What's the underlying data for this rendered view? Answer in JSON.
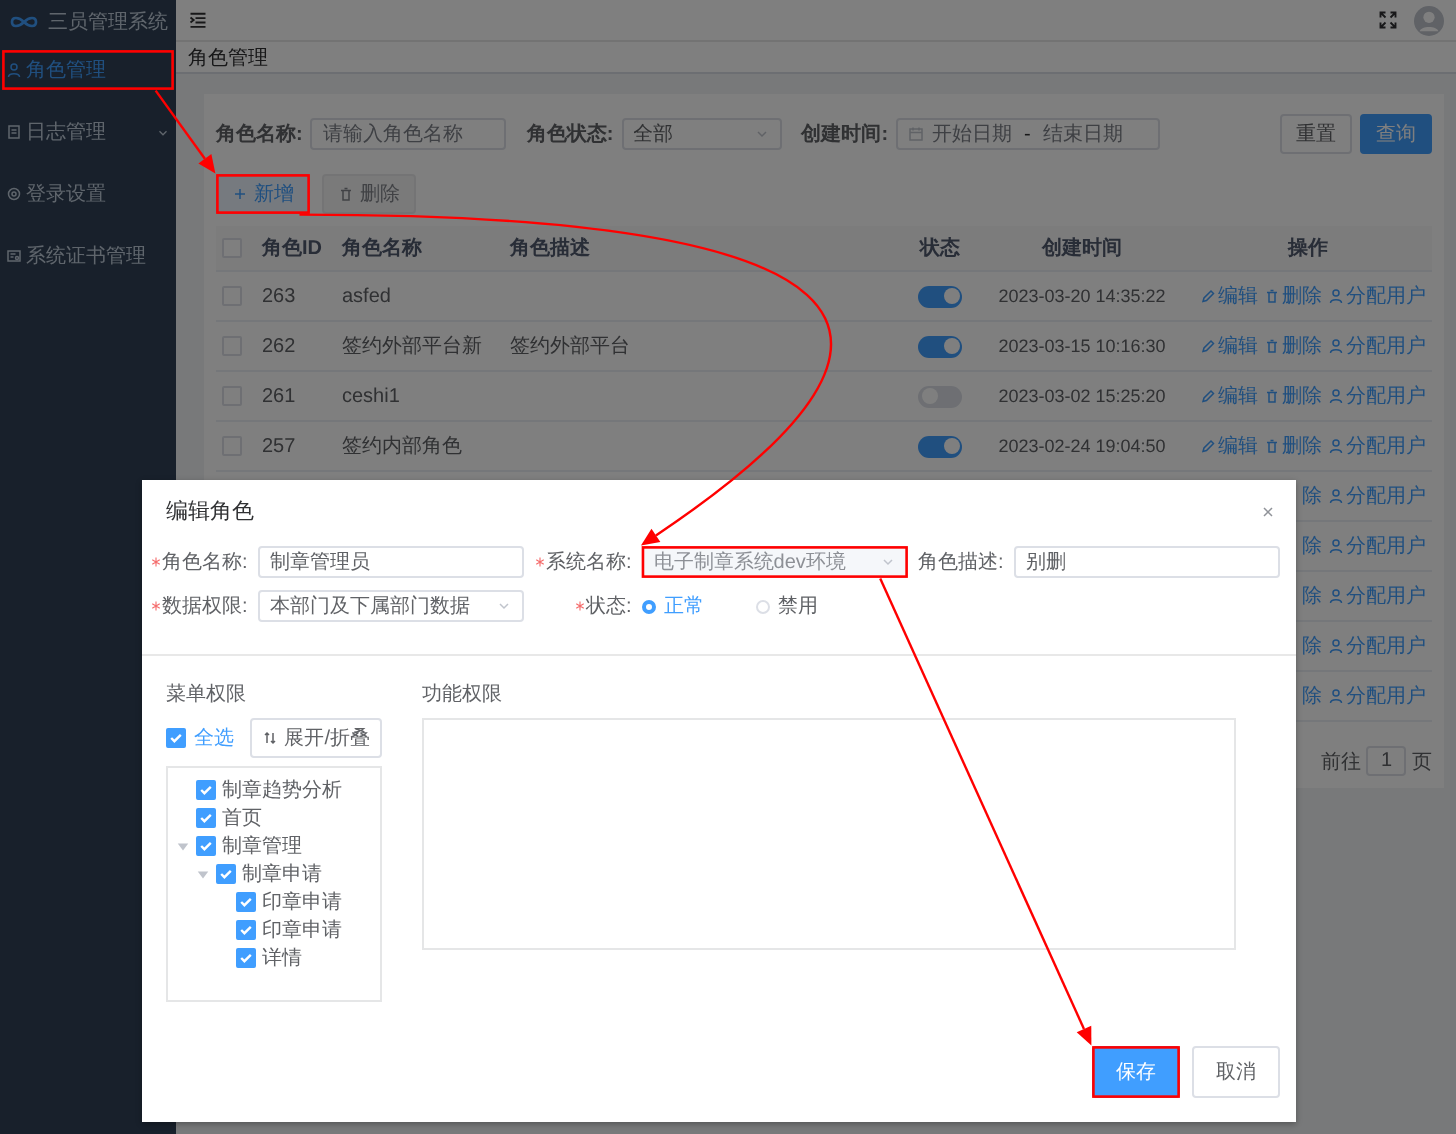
{
  "app": {
    "title": "三员管理系统"
  },
  "sidebar": {
    "items": [
      {
        "label": "角色管理",
        "selected": true,
        "submenu": false,
        "highlighted": true
      },
      {
        "label": "日志管理",
        "selected": false,
        "submenu": true,
        "highlighted": false
      },
      {
        "label": "登录设置",
        "selected": false,
        "submenu": false,
        "highlighted": false
      },
      {
        "label": "系统证书管理",
        "selected": false,
        "submenu": false,
        "highlighted": false
      }
    ]
  },
  "page_title": "角色管理",
  "filters": [
    {
      "kind": "input",
      "label": "角色名称:",
      "placeholder": "请输入角色名称"
    },
    {
      "kind": "select",
      "label": "角色状态:",
      "value": "全部"
    },
    {
      "kind": "daterange",
      "label": "创建时间:",
      "start_placeholder": "开始日期",
      "separator": "-",
      "end_placeholder": "结束日期"
    }
  ],
  "filter_buttons": [
    {
      "label": "重置",
      "primary": false
    },
    {
      "label": "查询",
      "primary": true
    }
  ],
  "toolbar": [
    {
      "kind": "add",
      "label": "新增",
      "disabled": false,
      "highlighted": true
    },
    {
      "kind": "delete",
      "label": "删除",
      "disabled": true,
      "highlighted": false
    }
  ],
  "table": {
    "select_all_checked": false,
    "columns": [
      "角色ID",
      "角色名称",
      "角色描述",
      "状态",
      "创建时间",
      "操作"
    ],
    "rows": [
      {
        "id": "263",
        "name": "asfed",
        "checked": false,
        "on": true,
        "created": "2023-03-20 14:35:22",
        "actions": [
          {
            "kind": "edit",
            "label": "编辑"
          },
          {
            "kind": "delete",
            "label": "删除"
          },
          {
            "kind": "assign",
            "label": "分配用户"
          }
        ]
      },
      {
        "id": "262",
        "name": "签约外部平台新",
        "description": "签约外部平台",
        "checked": false,
        "on": true,
        "created": "2023-03-15 10:16:30",
        "actions": [
          {
            "kind": "edit",
            "label": "编辑"
          },
          {
            "kind": "delete",
            "label": "删除"
          },
          {
            "kind": "assign",
            "label": "分配用户"
          }
        ]
      },
      {
        "id": "261",
        "name": "ceshi1",
        "checked": false,
        "on": false,
        "created": "2023-03-02 15:25:20",
        "actions": [
          {
            "kind": "edit",
            "label": "编辑"
          },
          {
            "kind": "delete",
            "label": "删除"
          },
          {
            "kind": "assign",
            "label": "分配用户"
          }
        ]
      },
      {
        "id": "257",
        "name": "签约内部角色",
        "checked": false,
        "on": true,
        "created": "2023-02-24 19:04:50",
        "actions": [
          {
            "kind": "edit",
            "label": "编辑"
          },
          {
            "kind": "delete",
            "label": "删除"
          },
          {
            "kind": "assign",
            "label": "分配用户"
          }
        ]
      },
      {
        "actions": [
          {
            "label": "除"
          },
          {
            "kind": "assign",
            "label": "分配用户"
          }
        ]
      },
      {
        "actions": [
          {
            "label": "除"
          },
          {
            "kind": "assign",
            "label": "分配用户"
          }
        ]
      },
      {
        "actions": [
          {
            "label": "除"
          },
          {
            "kind": "assign",
            "label": "分配用户"
          }
        ]
      },
      {
        "actions": [
          {
            "label": "除"
          },
          {
            "kind": "assign",
            "label": "分配用户"
          }
        ]
      },
      {
        "actions": [
          {
            "label": "除"
          },
          {
            "kind": "assign",
            "label": "分配用户"
          }
        ]
      }
    ]
  },
  "pagination": {
    "goto_label": "前往",
    "page": "1",
    "page_suffix": "页"
  },
  "modal": {
    "title": "编辑角色",
    "fields": [
      {
        "kind": "input",
        "label": "角色名称:",
        "required": true,
        "value": "制章管理员",
        "highlighted": false
      },
      {
        "kind": "select",
        "label": "系统名称:",
        "required": true,
        "value": "电子制章系统dev环境",
        "disabled": true,
        "highlighted": true
      },
      {
        "kind": "input",
        "label": "角色描述:",
        "required": false,
        "value": "别删",
        "highlighted": false
      },
      {
        "kind": "select",
        "label": "数据权限:",
        "required": true,
        "value": "本部门及下属部门数据",
        "disabled": false,
        "highlighted": false
      },
      {
        "kind": "radio",
        "label": "状态:",
        "required": true,
        "options": [
          {
            "label": "正常",
            "selected": true
          },
          {
            "label": "禁用",
            "selected": false
          }
        ]
      }
    ],
    "menu_permissions": {
      "label": "菜单权限",
      "select_all": {
        "label": "全选",
        "checked": true
      },
      "toggle_button": "展开/折叠",
      "tree": [
        {
          "label": "制章趋势分析",
          "checked": true
        },
        {
          "label": "首页",
          "checked": true
        },
        {
          "label": "制章管理",
          "checked": true,
          "expanded": true,
          "children": [
            {
              "label": "制章申请",
              "checked": true,
              "expanded": true,
              "children": [
                {
                  "label": "印章申请",
                  "checked": true
                },
                {
                  "label": "印章申请",
                  "checked": true
                },
                {
                  "label": "详情",
                  "checked": true
                }
              ]
            }
          ]
        }
      ]
    },
    "function_permissions": {
      "label": "功能权限"
    },
    "buttons": [
      {
        "label": "保存",
        "primary": true,
        "highlighted": true
      },
      {
        "label": "取消",
        "primary": false,
        "highlighted": false
      }
    ]
  }
}
